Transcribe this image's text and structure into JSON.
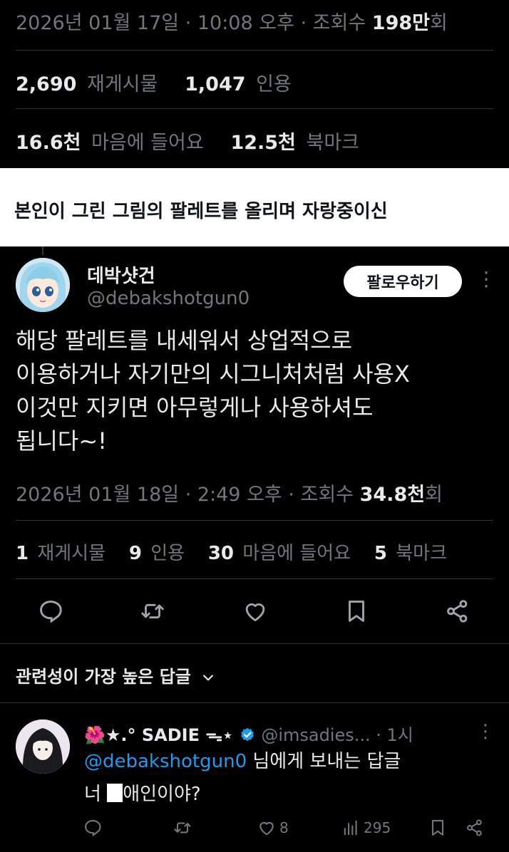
{
  "top_meta": {
    "date_time": "2026년 01월 17일 · 10:08 오후 · 조회수 ",
    "views_num": "198만",
    "views_suffix": "회",
    "reposts_num": "2,690",
    "reposts_label": "재게시물",
    "quotes_num": "1,047",
    "quotes_label": "인용",
    "likes_num": "16.6천",
    "likes_label": "마음에 들어요",
    "bookmarks_num": "12.5천",
    "bookmarks_label": "북마크"
  },
  "caption": "본인이 그린 그림의 팔레트를 올리며 자랑중이신",
  "tweet": {
    "display_name": "데박샷건",
    "handle": "@debakshotgun0",
    "follow_label": "팔로우하기",
    "more_icon": "⋮",
    "text": "해당 팔레트를 내세워서 상업적으로\n이용하거나 자기만의 시그니처처럼 사용X\n이것만 지키면 아무렇게나 사용하셔도\n됩니다~!",
    "date_time": "2026년 01월 18일 · 2:49 오후 · 조회수 ",
    "views_num": "34.8천",
    "views_suffix": "회",
    "reposts_num": "1",
    "reposts_label": "재게시물",
    "quotes_num": "9",
    "quotes_label": "인용",
    "likes_num": "30",
    "likes_label": "마음에 들어요",
    "bookmarks_num": "5",
    "bookmarks_label": "북마크"
  },
  "replies_header": "관련성이 가장 높은 답글",
  "reply": {
    "name_prefix": "🌺★.°",
    "name": "SADIE",
    "name_suffix": "ᯓ⋆",
    "handle": "@imsadies...",
    "time": "· 1시",
    "more_icon": "⋮",
    "to_handle": "@debakshotgun0",
    "to_suffix": " 님에게 보내는 답글",
    "text_before": "너 ",
    "text_after": "애인이야?",
    "likes": "8",
    "views": "295"
  },
  "colors": {
    "background": "#000000",
    "text": "#e7e9ea",
    "muted": "#71767b",
    "link": "#1d9bf0",
    "caption_bg": "#ffffff"
  }
}
